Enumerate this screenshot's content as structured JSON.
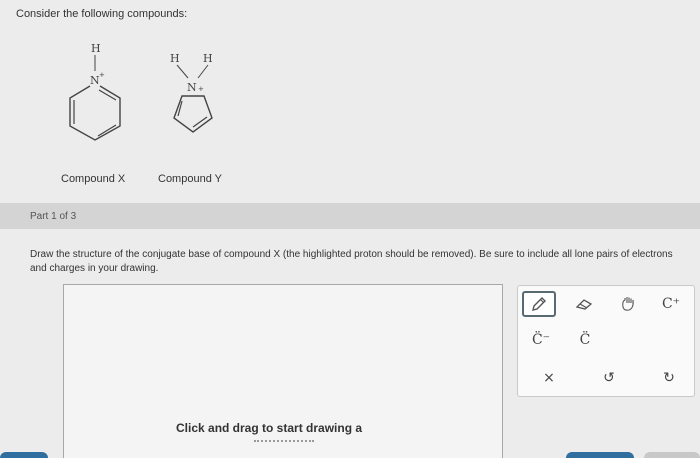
{
  "intro": "Consider the following compounds:",
  "compounds": [
    {
      "label": "Compound X",
      "h_atom": "H",
      "n_atom": "N",
      "charge": "+"
    },
    {
      "label": "Compound Y",
      "h1": "H",
      "h2": "H",
      "n_atom": "N",
      "charge": "+"
    }
  ],
  "part": {
    "label": "Part 1 of 3"
  },
  "question": "Draw the structure of the conjugate base of compound X (the highlighted proton should be removed). Be sure to include all lone pairs of electrons and charges in your drawing.",
  "canvas": {
    "hint": "Click and drag to start drawing a"
  },
  "toolbar": {
    "tools": [
      {
        "name": "pencil-icon",
        "text": ""
      },
      {
        "name": "eraser-icon",
        "text": ""
      },
      {
        "name": "glove-icon",
        "text": ""
      },
      {
        "name": "carbocation-tool",
        "text": "C⁺"
      },
      {
        "name": "carbanion-tool",
        "text": "C̈⁻"
      },
      {
        "name": "lone-pair-tool",
        "text": "C̈"
      },
      {
        "name": "clear-icon",
        "text": "×"
      },
      {
        "name": "undo-icon",
        "text": "↺"
      },
      {
        "name": "redo-icon",
        "text": "↻"
      }
    ]
  },
  "colors": {
    "accent": "#5a6a72",
    "part_bar": "#d4d4d4",
    "bottom_tab": "#2f6f9f"
  }
}
